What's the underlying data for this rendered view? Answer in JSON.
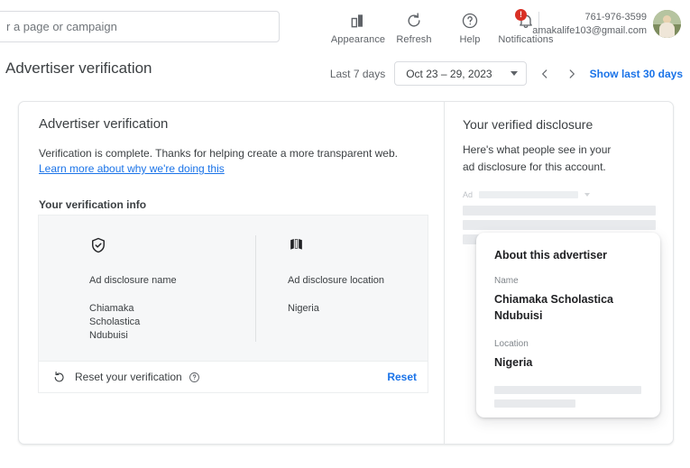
{
  "topbar": {
    "search": {
      "placeholder": "r a page or campaign",
      "value": ""
    },
    "nav": [
      {
        "label": "Appearance",
        "icon": "appearance-icon"
      },
      {
        "label": "Refresh",
        "icon": "refresh-icon"
      },
      {
        "label": "Help",
        "icon": "help-icon"
      },
      {
        "label": "Notifications",
        "icon": "notifications-icon",
        "badge": "!"
      }
    ],
    "account": {
      "phone": "761-976-3599",
      "email": "amakalife103@gmail.com"
    }
  },
  "header": {
    "title": "Advertiser verification",
    "date_label": "Last 7 days",
    "date_range": "Oct 23 – 29, 2023",
    "prev_icon": "chevron-left-icon",
    "next_icon": "chevron-right-icon",
    "show_last_30": "Show last 30 days"
  },
  "left_panel": {
    "title": "Advertiser verification",
    "description": "Verification is complete. Thanks for helping create a more transparent web.",
    "link": "Learn more about why we're doing this",
    "subtitle": "Your verification info",
    "info": [
      {
        "icon": "shield-check-icon",
        "label": "Ad disclosure name",
        "value": "Chiamaka Scholastica Ndubuisi"
      },
      {
        "icon": "map-icon",
        "label": "Ad disclosure location",
        "value": "Nigeria"
      }
    ],
    "reset": {
      "icon": "restore-icon",
      "text": "Reset your verification",
      "help_icon": "help-circle-icon",
      "action_label": "Reset"
    }
  },
  "right_panel": {
    "title": "Your verified disclosure",
    "description": "Here's what people see in your ad disclosure for this account.",
    "ad_preview": {
      "ad_label": "Ad",
      "caret_icon": "chevron-down-icon"
    },
    "about_card": {
      "title": "About this advertiser",
      "name_key": "Name",
      "name_value": "Chiamaka Scholastica Ndubuisi",
      "location_key": "Location",
      "location_value": "Nigeria"
    }
  },
  "colors": {
    "accent": "#1a73e8",
    "badge": "#d93025",
    "text": "#3c4043",
    "muted": "#5f6368",
    "panel_bg": "#f6f7f8"
  }
}
